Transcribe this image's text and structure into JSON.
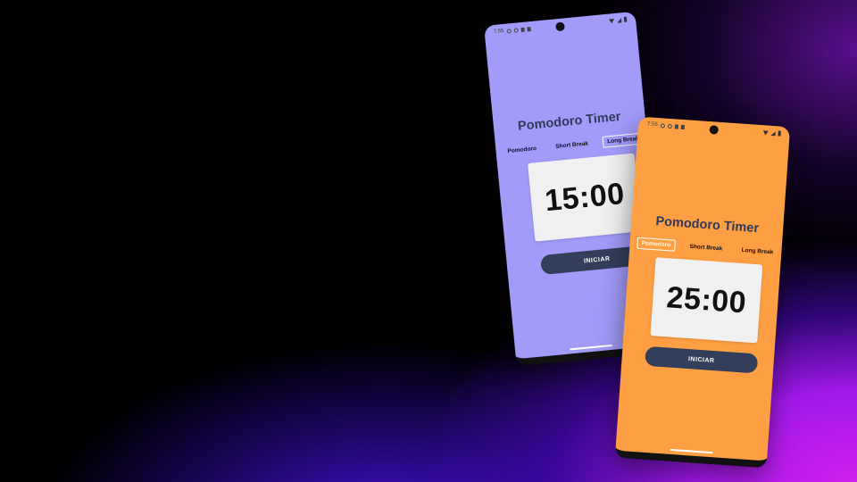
{
  "phones": [
    {
      "theme": "long-break",
      "background": "#a29bfa",
      "status": {
        "time": "7:55"
      },
      "title": "Pomodoro Timer",
      "tabs": [
        "Pomodoro",
        "Short Break",
        "Long Break"
      ],
      "active_tab": "Long Break",
      "timer": "15:00",
      "start_label": "INICIAR"
    },
    {
      "theme": "pomodoro",
      "background": "#ff9f43",
      "status": {
        "time": "7:55"
      },
      "title": "Pomodoro Timer",
      "tabs": [
        "Pomodoro",
        "Short Break",
        "Long Break"
      ],
      "active_tab": "Pomodoro",
      "timer": "25:00",
      "start_label": "INICIAR"
    }
  ],
  "colors": {
    "button": "#333f5a",
    "title": "#2f3a5a",
    "card": "#f0f0f0"
  },
  "icons": [
    "camera-icon",
    "wifi-icon",
    "signal-icon",
    "battery-icon",
    "notification-icon"
  ]
}
